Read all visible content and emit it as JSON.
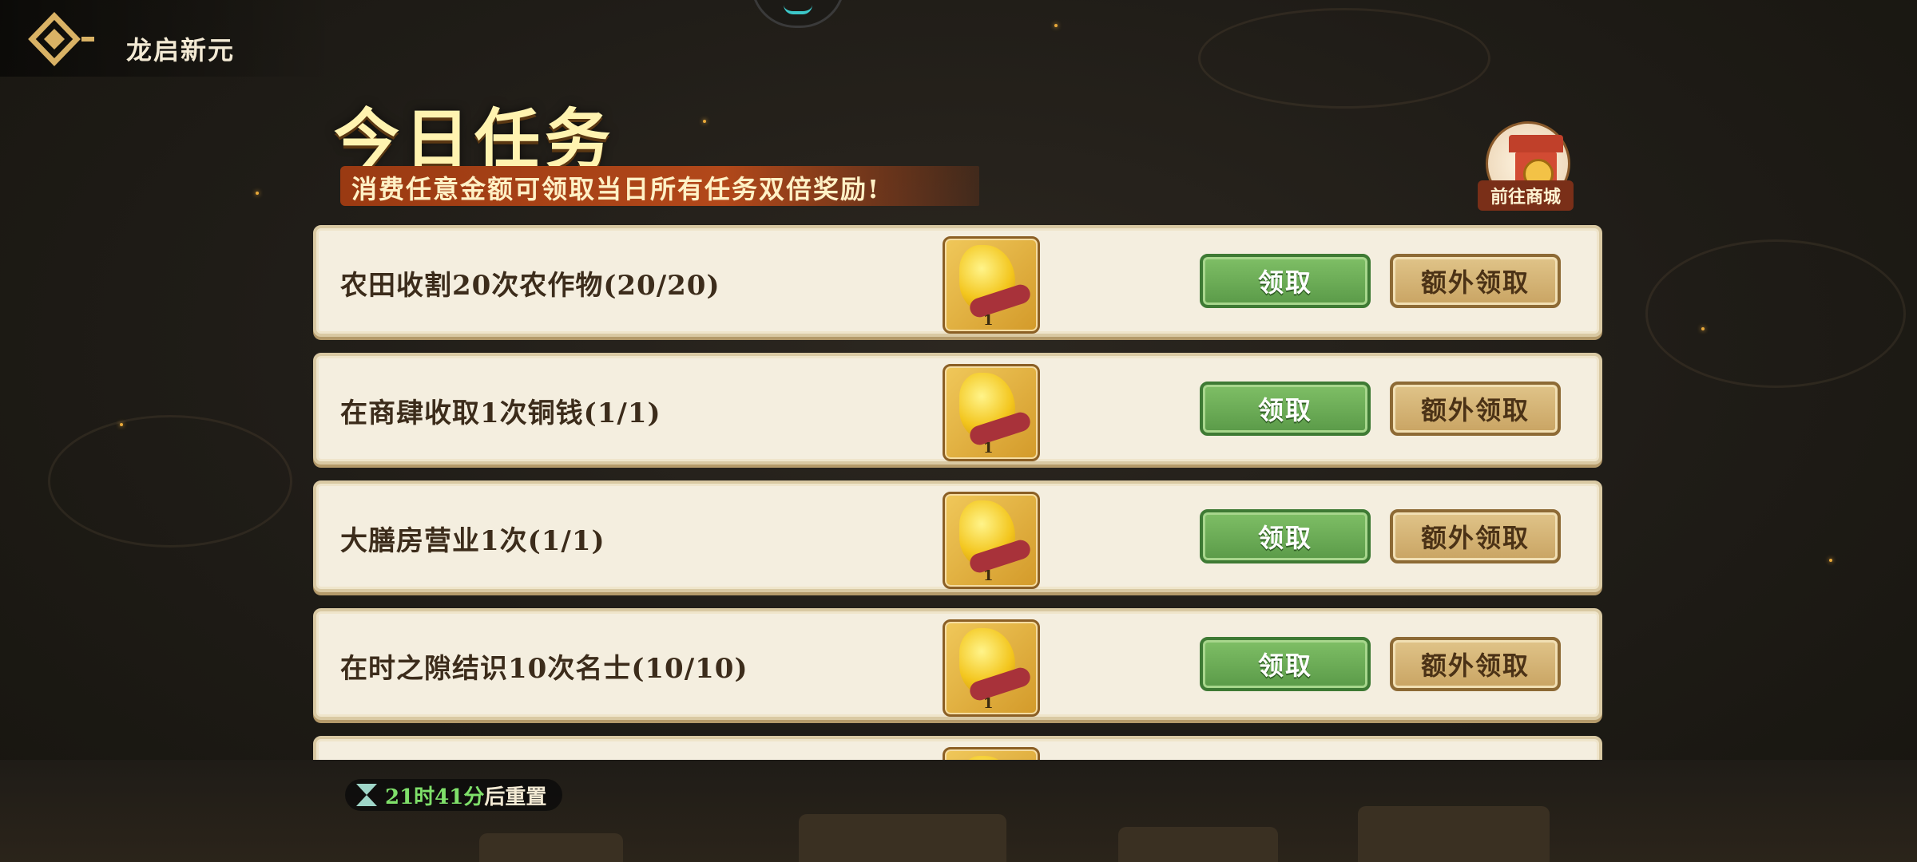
{
  "header": {
    "title": "龙启新元"
  },
  "page": {
    "title": "今日任务",
    "banner": "消费任意金额可领取当日所有任务双倍奖励!"
  },
  "shop": {
    "label": "前往商城",
    "icon": "shop-gate-icon"
  },
  "tasks": [
    {
      "label": "农田收割20次农作物(20/20)",
      "reward_count": "1",
      "claim": "领取",
      "extra": "额外领取"
    },
    {
      "label": "在商肆收取1次铜钱(1/1)",
      "reward_count": "1",
      "claim": "领取",
      "extra": "额外领取"
    },
    {
      "label": "大膳房营业1次(1/1)",
      "reward_count": "1",
      "claim": "领取",
      "extra": "额外领取"
    },
    {
      "label": "在时之隙结识10次名士(10/10)",
      "reward_count": "1",
      "claim": "领取",
      "extra": "额外领取"
    }
  ],
  "timer": {
    "time": "21时41分",
    "suffix": "后重置",
    "icon": "hourglass-icon"
  },
  "colors": {
    "claim": "#6aae55",
    "extra": "#d4b274",
    "banner": "#a9421a",
    "title": "#fff3b0"
  }
}
